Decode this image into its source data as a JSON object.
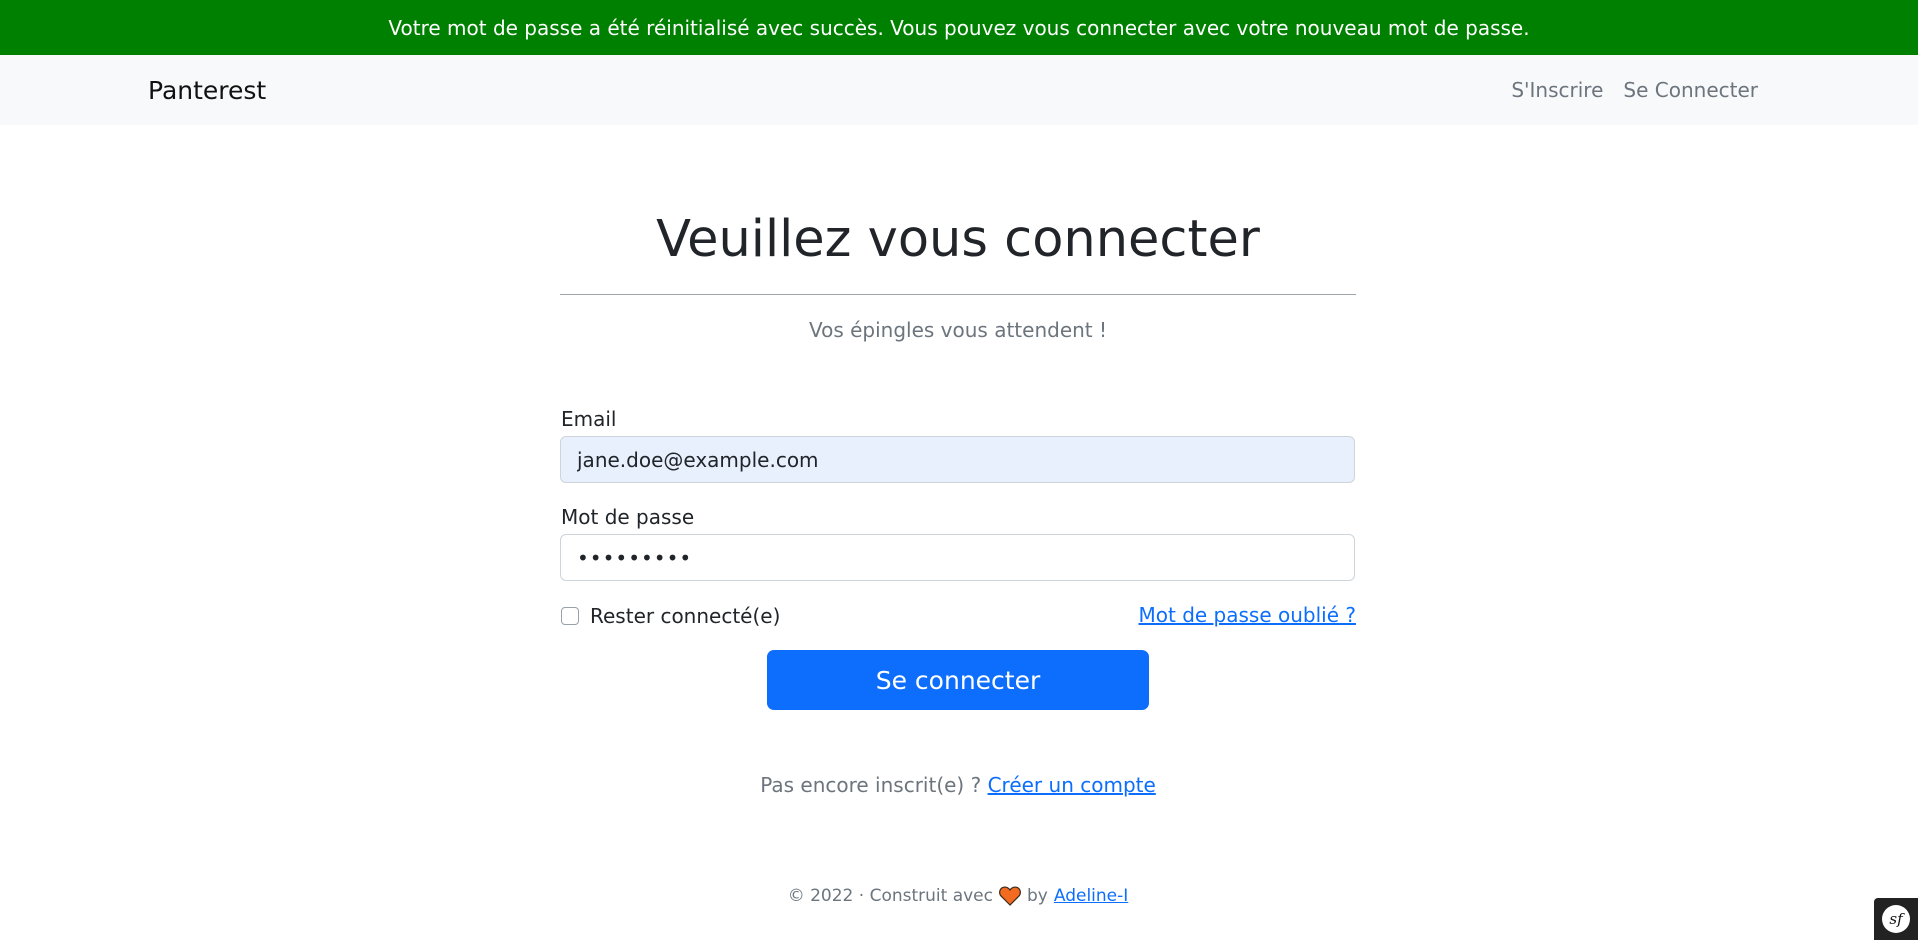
{
  "flash": {
    "message": "Votre mot de passe a été réinitialisé avec succès. Vous pouvez vous connecter avec votre nouveau mot de passe.",
    "color": "#008000"
  },
  "navbar": {
    "brand": "Panterest",
    "links": [
      "S'Inscrire",
      "Se Connecter"
    ]
  },
  "login": {
    "heading": "Veuillez vous connecter",
    "subtitle": "Vos épingles vous attendent !",
    "email_label": "Email",
    "email_value": "jane.doe@example.com",
    "password_label": "Mot de passe",
    "password_value": "•••••••••",
    "remember_label": "Rester connecté(e)",
    "remember_checked": false,
    "forgot_link": "Mot de passe oublié ?",
    "submit_label": "Se connecter",
    "signup_prompt": "Pas encore inscrit(e) ?",
    "signup_link": "Créer un compte"
  },
  "footer": {
    "prefix": "© 2022 · Construit avec",
    "heart_icon": "heart-icon",
    "by": "by",
    "author": "Adeline-I"
  },
  "debug_toolbar": {
    "icon": "symfony-icon",
    "glyph": "sf"
  },
  "colors": {
    "primary": "#0d6efd",
    "success": "#008000",
    "heart": "#f26b21"
  }
}
